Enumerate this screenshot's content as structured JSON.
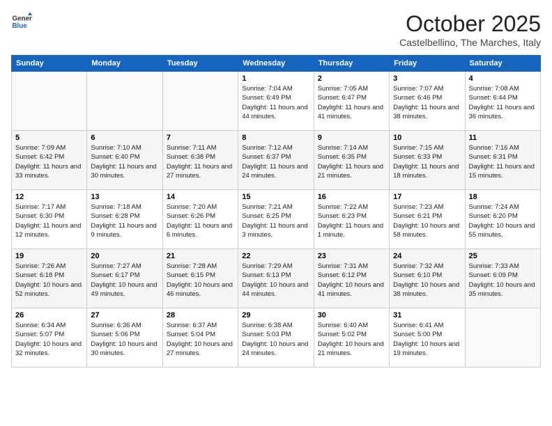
{
  "logo": {
    "line1": "General",
    "line2": "Blue"
  },
  "title": "October 2025",
  "subtitle": "Castelbellino, The Marches, Italy",
  "weekdays": [
    "Sunday",
    "Monday",
    "Tuesday",
    "Wednesday",
    "Thursday",
    "Friday",
    "Saturday"
  ],
  "weeks": [
    [
      {
        "day": "",
        "info": ""
      },
      {
        "day": "",
        "info": ""
      },
      {
        "day": "",
        "info": ""
      },
      {
        "day": "1",
        "info": "Sunrise: 7:04 AM\nSunset: 6:49 PM\nDaylight: 11 hours and 44 minutes."
      },
      {
        "day": "2",
        "info": "Sunrise: 7:05 AM\nSunset: 6:47 PM\nDaylight: 11 hours and 41 minutes."
      },
      {
        "day": "3",
        "info": "Sunrise: 7:07 AM\nSunset: 6:46 PM\nDaylight: 11 hours and 38 minutes."
      },
      {
        "day": "4",
        "info": "Sunrise: 7:08 AM\nSunset: 6:44 PM\nDaylight: 11 hours and 36 minutes."
      }
    ],
    [
      {
        "day": "5",
        "info": "Sunrise: 7:09 AM\nSunset: 6:42 PM\nDaylight: 11 hours and 33 minutes."
      },
      {
        "day": "6",
        "info": "Sunrise: 7:10 AM\nSunset: 6:40 PM\nDaylight: 11 hours and 30 minutes."
      },
      {
        "day": "7",
        "info": "Sunrise: 7:11 AM\nSunset: 6:38 PM\nDaylight: 11 hours and 27 minutes."
      },
      {
        "day": "8",
        "info": "Sunrise: 7:12 AM\nSunset: 6:37 PM\nDaylight: 11 hours and 24 minutes."
      },
      {
        "day": "9",
        "info": "Sunrise: 7:14 AM\nSunset: 6:35 PM\nDaylight: 11 hours and 21 minutes."
      },
      {
        "day": "10",
        "info": "Sunrise: 7:15 AM\nSunset: 6:33 PM\nDaylight: 11 hours and 18 minutes."
      },
      {
        "day": "11",
        "info": "Sunrise: 7:16 AM\nSunset: 6:31 PM\nDaylight: 11 hours and 15 minutes."
      }
    ],
    [
      {
        "day": "12",
        "info": "Sunrise: 7:17 AM\nSunset: 6:30 PM\nDaylight: 11 hours and 12 minutes."
      },
      {
        "day": "13",
        "info": "Sunrise: 7:18 AM\nSunset: 6:28 PM\nDaylight: 11 hours and 9 minutes."
      },
      {
        "day": "14",
        "info": "Sunrise: 7:20 AM\nSunset: 6:26 PM\nDaylight: 11 hours and 6 minutes."
      },
      {
        "day": "15",
        "info": "Sunrise: 7:21 AM\nSunset: 6:25 PM\nDaylight: 11 hours and 3 minutes."
      },
      {
        "day": "16",
        "info": "Sunrise: 7:22 AM\nSunset: 6:23 PM\nDaylight: 11 hours and 1 minute."
      },
      {
        "day": "17",
        "info": "Sunrise: 7:23 AM\nSunset: 6:21 PM\nDaylight: 10 hours and 58 minutes."
      },
      {
        "day": "18",
        "info": "Sunrise: 7:24 AM\nSunset: 6:20 PM\nDaylight: 10 hours and 55 minutes."
      }
    ],
    [
      {
        "day": "19",
        "info": "Sunrise: 7:26 AM\nSunset: 6:18 PM\nDaylight: 10 hours and 52 minutes."
      },
      {
        "day": "20",
        "info": "Sunrise: 7:27 AM\nSunset: 6:17 PM\nDaylight: 10 hours and 49 minutes."
      },
      {
        "day": "21",
        "info": "Sunrise: 7:28 AM\nSunset: 6:15 PM\nDaylight: 10 hours and 46 minutes."
      },
      {
        "day": "22",
        "info": "Sunrise: 7:29 AM\nSunset: 6:13 PM\nDaylight: 10 hours and 44 minutes."
      },
      {
        "day": "23",
        "info": "Sunrise: 7:31 AM\nSunset: 6:12 PM\nDaylight: 10 hours and 41 minutes."
      },
      {
        "day": "24",
        "info": "Sunrise: 7:32 AM\nSunset: 6:10 PM\nDaylight: 10 hours and 38 minutes."
      },
      {
        "day": "25",
        "info": "Sunrise: 7:33 AM\nSunset: 6:09 PM\nDaylight: 10 hours and 35 minutes."
      }
    ],
    [
      {
        "day": "26",
        "info": "Sunrise: 6:34 AM\nSunset: 5:07 PM\nDaylight: 10 hours and 32 minutes."
      },
      {
        "day": "27",
        "info": "Sunrise: 6:36 AM\nSunset: 5:06 PM\nDaylight: 10 hours and 30 minutes."
      },
      {
        "day": "28",
        "info": "Sunrise: 6:37 AM\nSunset: 5:04 PM\nDaylight: 10 hours and 27 minutes."
      },
      {
        "day": "29",
        "info": "Sunrise: 6:38 AM\nSunset: 5:03 PM\nDaylight: 10 hours and 24 minutes."
      },
      {
        "day": "30",
        "info": "Sunrise: 6:40 AM\nSunset: 5:02 PM\nDaylight: 10 hours and 21 minutes."
      },
      {
        "day": "31",
        "info": "Sunrise: 6:41 AM\nSunset: 5:00 PM\nDaylight: 10 hours and 19 minutes."
      },
      {
        "day": "",
        "info": ""
      }
    ]
  ]
}
